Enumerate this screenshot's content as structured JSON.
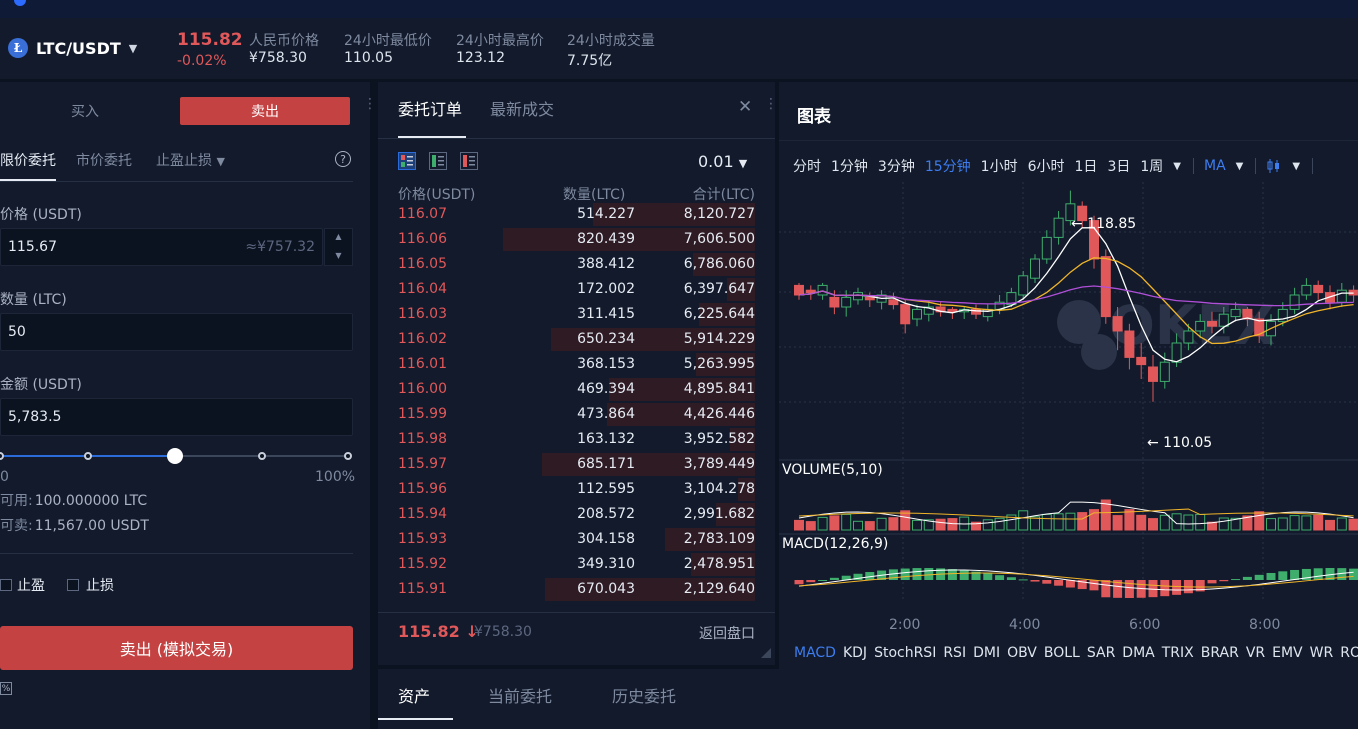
{
  "ticker": {
    "pair": "LTC/USDT",
    "coin_icon": "Ł",
    "last_price": "115.82",
    "change": "-0.02%",
    "stats": [
      {
        "label": "人民币价格",
        "value": "¥758.30"
      },
      {
        "label": "24小时最低价",
        "value": "110.05"
      },
      {
        "label": "24小时最高价",
        "value": "123.12"
      },
      {
        "label": "24小时成交量",
        "value": "7.75亿"
      }
    ]
  },
  "trade": {
    "tab_buy": "买入",
    "tab_sell": "卖出",
    "order_types": [
      "限价委托",
      "市价委托",
      "止盈止损"
    ],
    "price_label": "价格 (USDT)",
    "price_value": "115.67",
    "price_cny": "≈¥757.32",
    "qty_label": "数量 (LTC)",
    "qty_value": "50",
    "amount_label": "金额 (USDT)",
    "amount_value": "5,783.5",
    "slider_min": "0",
    "slider_max": "100%",
    "slider_level_pct": 50,
    "available_label": "可用:",
    "available_value": "100.000000 LTC",
    "sellable_label": "可卖:",
    "sellable_value": "11,567.00 USDT",
    "take_profit": "止盈",
    "stop_loss": "止损",
    "submit": "卖出 (模拟交易)",
    "fee_icon": "%"
  },
  "book": {
    "tab_orders": "委托订单",
    "tab_trades": "最新成交",
    "precision": "0.01",
    "col_price": "价格(USDT)",
    "col_qty": "数量(LTC)",
    "col_total": "合计(LTC)",
    "rows": [
      {
        "price": "116.07",
        "qty": "514.227",
        "total": "8,120.727",
        "depth": 0.58
      },
      {
        "price": "116.06",
        "qty": "820.439",
        "total": "7,606.500",
        "depth": 0.9
      },
      {
        "price": "116.05",
        "qty": "388.412",
        "total": "6,786.060",
        "depth": 0.22
      },
      {
        "price": "116.04",
        "qty": "172.002",
        "total": "6,397.647",
        "depth": 0.1
      },
      {
        "price": "116.03",
        "qty": "311.415",
        "total": "6,225.644",
        "depth": 0.2
      },
      {
        "price": "116.02",
        "qty": "650.234",
        "total": "5,914.229",
        "depth": 0.73
      },
      {
        "price": "116.01",
        "qty": "368.153",
        "total": "5,263.995",
        "depth": 0.21
      },
      {
        "price": "116.00",
        "qty": "469.394",
        "total": "4,895.841",
        "depth": 0.52
      },
      {
        "price": "115.99",
        "qty": "473.864",
        "total": "4,426.446",
        "depth": 0.53
      },
      {
        "price": "115.98",
        "qty": "163.132",
        "total": "3,952.582",
        "depth": 0.09
      },
      {
        "price": "115.97",
        "qty": "685.171",
        "total": "3,789.449",
        "depth": 0.76
      },
      {
        "price": "115.96",
        "qty": "112.595",
        "total": "3,104.278",
        "depth": 0.06
      },
      {
        "price": "115.94",
        "qty": "208.572",
        "total": "2,991.682",
        "depth": 0.14
      },
      {
        "price": "115.93",
        "qty": "304.158",
        "total": "2,783.109",
        "depth": 0.32
      },
      {
        "price": "115.92",
        "qty": "349.310",
        "total": "2,478.951",
        "depth": 0.23
      },
      {
        "price": "115.91",
        "qty": "670.043",
        "total": "2,129.640",
        "depth": 0.75
      }
    ],
    "last_price": "115.82 ↓",
    "last_cny": "¥758.30",
    "back_link": "返回盘口"
  },
  "chart": {
    "title": "图表",
    "timeframes": [
      "分时",
      "1分钟",
      "3分钟",
      "15分钟",
      "1小时",
      "6小时",
      "1日",
      "3日",
      "1周"
    ],
    "active_timeframe": "15分钟",
    "ma_label": "MA",
    "high_label": "← 118.85",
    "low_label": "← 110.05",
    "volume_label": "VOLUME(5,10)",
    "macd_label": "MACD(12,26,9)",
    "time_labels": [
      "2:00",
      "4:00",
      "6:00",
      "8:00"
    ],
    "indicators": [
      "MACD",
      "KDJ",
      "StochRSI",
      "RSI",
      "DMI",
      "OBV",
      "BOLL",
      "SAR",
      "DMA",
      "TRIX",
      "BRAR",
      "VR",
      "EMV",
      "WR",
      "RO"
    ],
    "watermark": "OKEX",
    "up_color": "#3fae6d",
    "down_color": "#e0585a"
  },
  "bottom_tabs": [
    "资产",
    "当前委托",
    "历史委托"
  ]
}
